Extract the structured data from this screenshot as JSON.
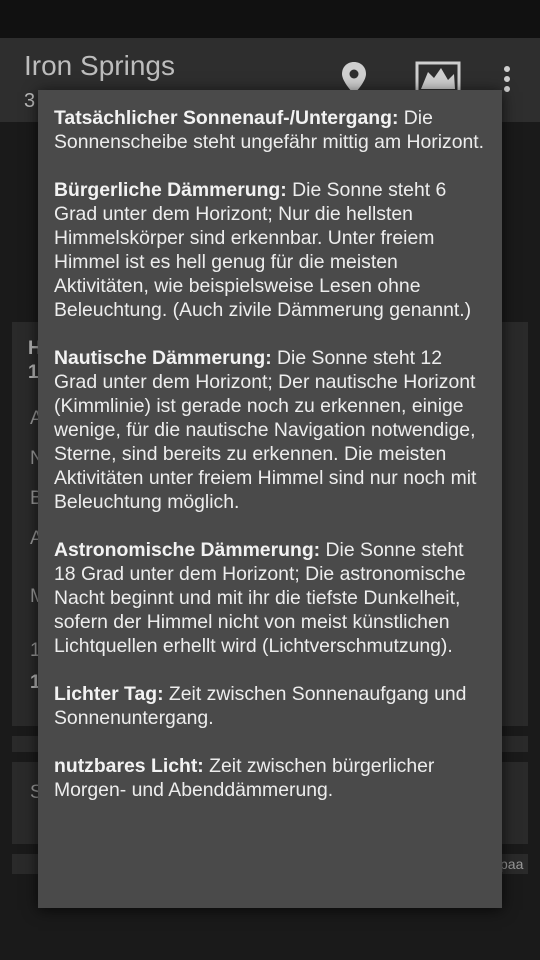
{
  "app": {
    "title": "Iron Springs",
    "subtitle": "3",
    "icons": [
      "location-pin-icon",
      "map-icon",
      "overflow-menu-icon"
    ]
  },
  "background_fragments": {
    "card_heading": "H",
    "card_heading_2": "1",
    "row_1": "A",
    "row_2": "N",
    "row_3": "B",
    "row_4": "A",
    "row_5": "M",
    "row_6": "1",
    "row_7": "1",
    "card2_text": "S",
    "footer_text": "paa"
  },
  "dialog": {
    "paragraphs": [
      {
        "term": "Tatsächlicher Sonnenauf-/Untergang:",
        "text": " Die Sonnenscheibe steht ungefähr mittig am Horizont."
      },
      {
        "term": "Bürgerliche Dämmerung:",
        "text": " Die Sonne steht 6 Grad unter dem Horizont; Nur die hellsten Himmelskörper sind erkennbar. Unter freiem Himmel ist es hell genug für die meisten Aktivitäten, wie beispielsweise Lesen ohne Beleuchtung. (Auch zivile Dämmerung genannt.)"
      },
      {
        "term": "Nautische Dämmerung:",
        "text": " Die Sonne steht 12 Grad unter dem Horizont; Der nautische Horizont (Kimmlinie) ist gerade noch zu erkennen, einige wenige, für die nautische Navigation notwendige, Sterne, sind bereits zu erkennen. Die meisten Aktivitäten unter freiem Himmel sind nur noch mit Beleuchtung möglich."
      },
      {
        "term": "Astronomische Dämmerung:",
        "text": " Die Sonne steht 18 Grad unter dem Horizont; Die astronomische Nacht beginnt und mit ihr die tiefste Dunkelheit, sofern der Himmel nicht von meist künstlichen Lichtquellen erhellt wird (Lichtverschmutzung)."
      },
      {
        "term": "Lichter Tag:",
        "text": " Zeit zwischen Sonnenaufgang und Sonnenuntergang."
      },
      {
        "term": "nutzbares Licht:",
        "text": " Zeit zwischen bürgerlicher Morgen- und Abenddämmerung."
      }
    ]
  }
}
